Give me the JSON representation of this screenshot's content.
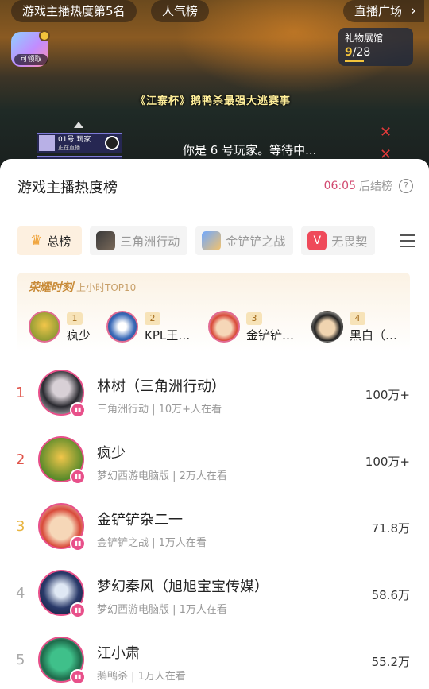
{
  "stream": {
    "rank_pill": "游戏主播热度第5名",
    "popularity_pill": "人气榜",
    "plaza_pill": "直播广场",
    "gift_badge_label": "可领取",
    "gift_gallery": {
      "title": "礼物展馆",
      "current": "9",
      "total": "/28"
    },
    "banner": "《江寨杯》鹅鸭杀最强大逃赛事",
    "player_tag": "01号 玩家",
    "player_sub": "正在直播...",
    "wait_text": "你是 6 号玩家。等待中..."
  },
  "panel": {
    "title": "游戏主播热度榜",
    "countdown_time": "06:05",
    "countdown_suffix": "后结榜",
    "help_icon": "?"
  },
  "tabs": [
    {
      "label": "总榜",
      "icon": "crown-icon"
    },
    {
      "label": "三角洲行动",
      "icon": "delta-force-icon"
    },
    {
      "label": "金铲铲之战",
      "icon": "tft-icon"
    },
    {
      "label": "无畏契",
      "icon": "valorant-icon"
    }
  ],
  "honor": {
    "title": "荣耀时刻",
    "subtitle": "上小时TOP10",
    "items": [
      {
        "rank": "1",
        "name": "疯少"
      },
      {
        "rank": "2",
        "name": "KPL王…"
      },
      {
        "rank": "3",
        "name": "金铲铲…"
      },
      {
        "rank": "4",
        "name": "黑白（…"
      }
    ]
  },
  "rows": [
    {
      "rank": "1",
      "name": "林树（三角洲行动）",
      "meta": "三角洲行动 | 10万+人在看",
      "score": "100万+"
    },
    {
      "rank": "2",
      "name": "疯少",
      "meta": "梦幻西游电脑版 | 2万人在看",
      "score": "100万+"
    },
    {
      "rank": "3",
      "name": "金铲铲杂二一",
      "meta": "金铲铲之战 | 1万人在看",
      "score": "71.8万"
    },
    {
      "rank": "4",
      "name": "梦幻秦风（旭旭宝宝传媒）",
      "meta": "梦幻西游电脑版 | 1万人在看",
      "score": "58.6万"
    },
    {
      "rank": "5",
      "name": "江小肃",
      "meta": "鹅鸭杀 | 1万人在看",
      "score": "55.2万"
    }
  ],
  "colors": {
    "accent": "#d24a70",
    "rank_top": "#e0534a",
    "rank_third": "#e8b440",
    "avatar_ring": "#e8508a"
  }
}
